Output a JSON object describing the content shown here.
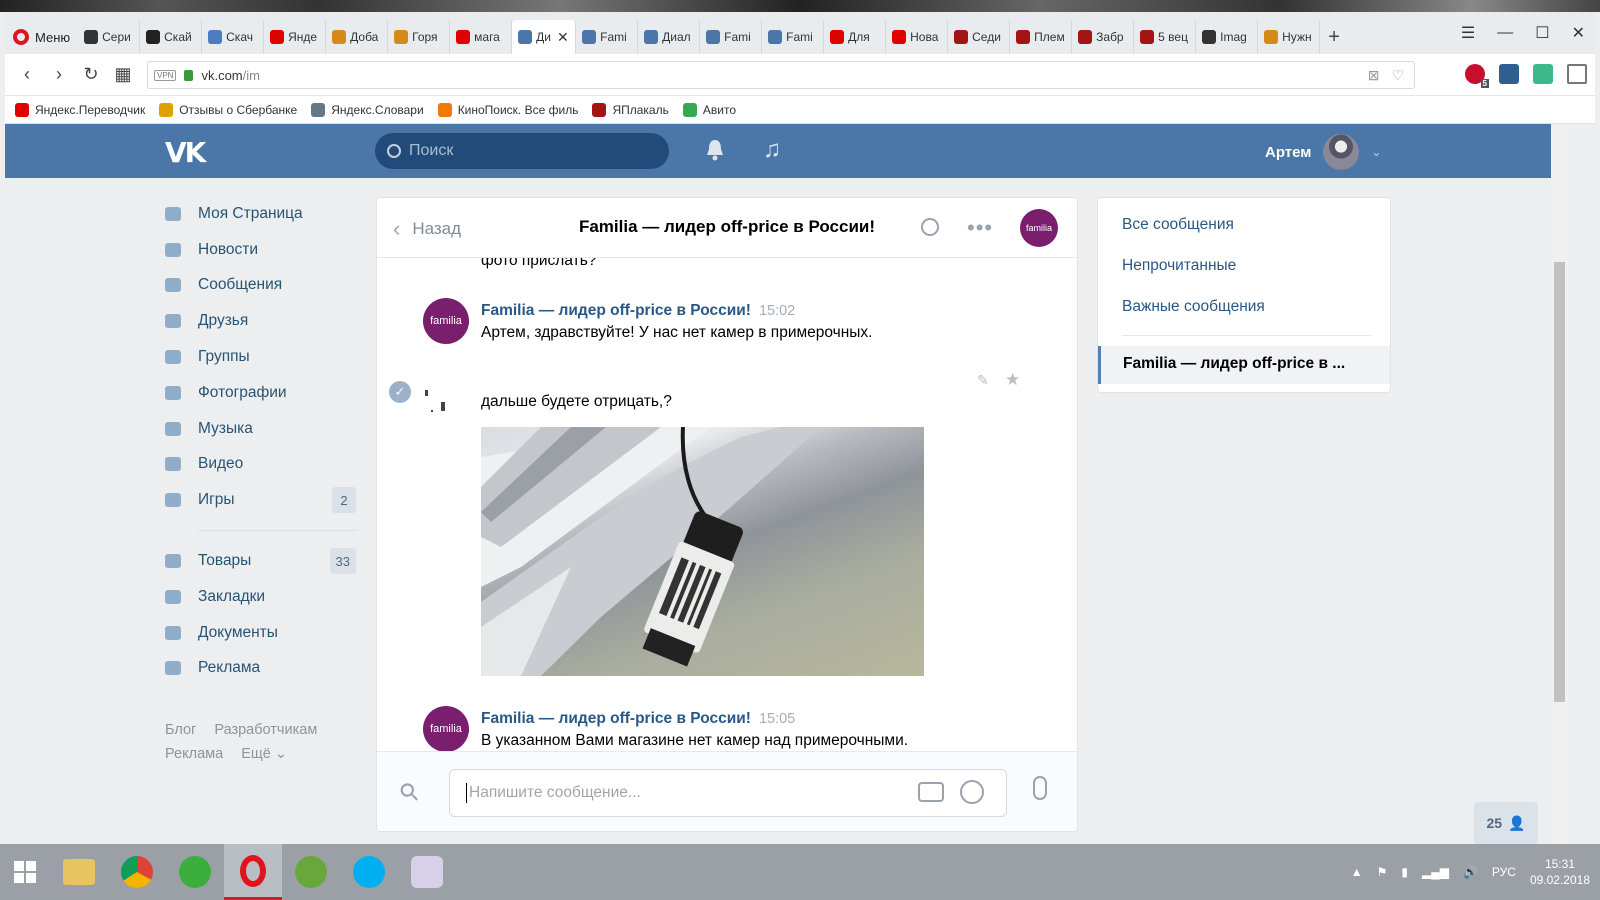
{
  "browser": {
    "menu_label": "Меню",
    "tabs": [
      {
        "label": "Сери",
        "color": "#333333"
      },
      {
        "label": "Скай",
        "color": "#222222"
      },
      {
        "label": "Скач",
        "color": "#4a7cc2"
      },
      {
        "label": "Янде",
        "color": "#e00000"
      },
      {
        "label": "Доба",
        "color": "#d68a1a"
      },
      {
        "label": "Горя",
        "color": "#d68a1a"
      },
      {
        "label": "мага",
        "color": "#e00000"
      },
      {
        "label": "Ди",
        "color": "#4a76a8",
        "active": true
      },
      {
        "label": "Fami",
        "color": "#4a76a8"
      },
      {
        "label": "Диал",
        "color": "#4a76a8"
      },
      {
        "label": "Fami",
        "color": "#4a76a8"
      },
      {
        "label": "Fami",
        "color": "#4a76a8"
      },
      {
        "label": "Для ",
        "color": "#e00000"
      },
      {
        "label": "Нова",
        "color": "#e00000"
      },
      {
        "label": "Седи",
        "color": "#a31515"
      },
      {
        "label": "Плем",
        "color": "#a31515"
      },
      {
        "label": "Забр",
        "color": "#a31515"
      },
      {
        "label": "5 вец",
        "color": "#a31515"
      },
      {
        "label": "Imag",
        "color": "#333333"
      },
      {
        "label": "Нужн",
        "color": "#d68a1a"
      }
    ],
    "new_tab": "+",
    "url_host": "vk.com",
    "url_path": "/im",
    "vpn_label": "VPN",
    "bookmarks": [
      {
        "label": "Яндекс.Переводчик",
        "color": "#e00000"
      },
      {
        "label": "Отзывы о Сбербанке",
        "color": "#e0a000"
      },
      {
        "label": "Яндекс.Словари",
        "color": "#667788"
      },
      {
        "label": "КиноПоиск. Все филь",
        "color": "#f07a00"
      },
      {
        "label": "ЯПлакаль",
        "color": "#a31515"
      },
      {
        "label": "Авито",
        "color": "#36a852"
      }
    ],
    "ext_badge": "5"
  },
  "vk": {
    "logo": "VK",
    "search_placeholder": "Поиск",
    "user_name": "Артем",
    "nav": [
      {
        "label": "Моя Страница",
        "icon": "home-icon"
      },
      {
        "label": "Новости",
        "icon": "news-icon"
      },
      {
        "label": "Сообщения",
        "icon": "messages-icon"
      },
      {
        "label": "Друзья",
        "icon": "friends-icon"
      },
      {
        "label": "Группы",
        "icon": "groups-icon"
      },
      {
        "label": "Фотографии",
        "icon": "camera-icon"
      },
      {
        "label": "Музыка",
        "icon": "music-icon"
      },
      {
        "label": "Видео",
        "icon": "video-icon"
      },
      {
        "label": "Игры",
        "icon": "games-icon",
        "badge": "2"
      }
    ],
    "nav2": [
      {
        "label": "Товары",
        "icon": "bag-icon",
        "badge": "33"
      },
      {
        "label": "Закладки",
        "icon": "star-icon"
      },
      {
        "label": "Документы",
        "icon": "document-icon"
      },
      {
        "label": "Реклама",
        "icon": "megaphone-icon"
      }
    ],
    "footer": [
      "Блог",
      "Разработчикам",
      "Реклама",
      "Ещё ⌄"
    ]
  },
  "chat": {
    "back_label": "Назад",
    "title": "Familia — лидер off-price в России!",
    "avatar_text": "familia",
    "cut_text": "фото прислать?",
    "messages": [
      {
        "author": "Familia — лидер off-price в России!",
        "time": "15:02",
        "text": "Артем, здравствуйте! У нас нет камер в примерочных."
      },
      {
        "text": "дальше будете отрицать,?"
      },
      {
        "author": "Familia — лидер off-price в России!",
        "time": "15:05",
        "text": "В указанном Вами магазине нет камер над примерочными."
      }
    ],
    "input_placeholder": "Напишите сообщение..."
  },
  "right_panel": {
    "items": [
      "Все сообщения",
      "Непрочитанные",
      "Важные сообщения"
    ],
    "active": "Familia — лидер off-price в ..."
  },
  "online_count": "25",
  "taskbar": {
    "lang": "РУС",
    "time": "15:31",
    "date": "09.02.2018"
  }
}
